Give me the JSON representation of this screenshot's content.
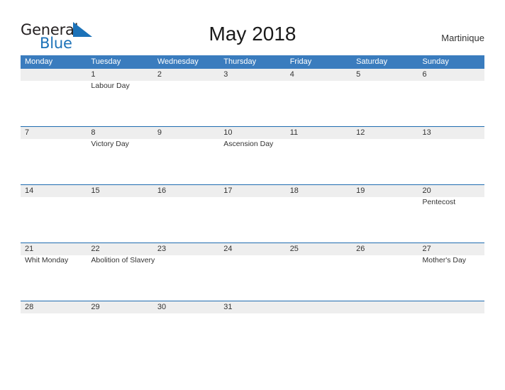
{
  "brand": {
    "name_part1": "General",
    "name_part2": "Blue",
    "flag_icon": "flag-triangle-icon",
    "accent_color": "#1c72b8"
  },
  "header": {
    "title": "May 2018",
    "region": "Martinique"
  },
  "colors": {
    "header_blue": "#3a7cbe",
    "row_divider_blue": "#1f6cb0",
    "day_shade": "#eeeeee",
    "text": "#333333"
  },
  "calendar": {
    "weekdays": [
      "Monday",
      "Tuesday",
      "Wednesday",
      "Thursday",
      "Friday",
      "Saturday",
      "Sunday"
    ],
    "weeks": [
      [
        {
          "day": "",
          "event": ""
        },
        {
          "day": "1",
          "event": "Labour Day"
        },
        {
          "day": "2",
          "event": ""
        },
        {
          "day": "3",
          "event": ""
        },
        {
          "day": "4",
          "event": ""
        },
        {
          "day": "5",
          "event": ""
        },
        {
          "day": "6",
          "event": ""
        }
      ],
      [
        {
          "day": "7",
          "event": ""
        },
        {
          "day": "8",
          "event": "Victory Day"
        },
        {
          "day": "9",
          "event": ""
        },
        {
          "day": "10",
          "event": "Ascension Day"
        },
        {
          "day": "11",
          "event": ""
        },
        {
          "day": "12",
          "event": ""
        },
        {
          "day": "13",
          "event": ""
        }
      ],
      [
        {
          "day": "14",
          "event": ""
        },
        {
          "day": "15",
          "event": ""
        },
        {
          "day": "16",
          "event": ""
        },
        {
          "day": "17",
          "event": ""
        },
        {
          "day": "18",
          "event": ""
        },
        {
          "day": "19",
          "event": ""
        },
        {
          "day": "20",
          "event": "Pentecost"
        }
      ],
      [
        {
          "day": "21",
          "event": "Whit Monday"
        },
        {
          "day": "22",
          "event": "Abolition of Slavery"
        },
        {
          "day": "23",
          "event": ""
        },
        {
          "day": "24",
          "event": ""
        },
        {
          "day": "25",
          "event": ""
        },
        {
          "day": "26",
          "event": ""
        },
        {
          "day": "27",
          "event": "Mother's Day"
        }
      ],
      [
        {
          "day": "28",
          "event": ""
        },
        {
          "day": "29",
          "event": ""
        },
        {
          "day": "30",
          "event": ""
        },
        {
          "day": "31",
          "event": ""
        },
        {
          "day": "",
          "event": ""
        },
        {
          "day": "",
          "event": ""
        },
        {
          "day": "",
          "event": ""
        }
      ]
    ]
  }
}
